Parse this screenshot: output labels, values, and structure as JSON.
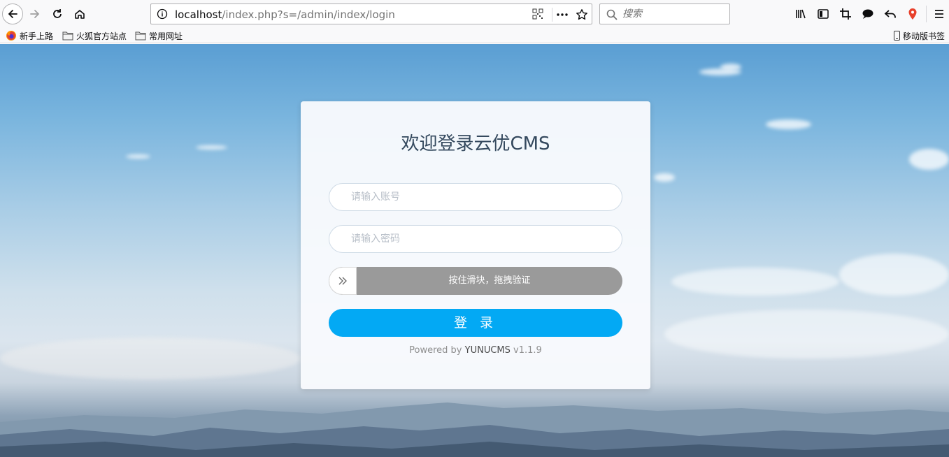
{
  "browser": {
    "url_host": "localhost",
    "url_path": "/index.php?s=/admin/index/login",
    "search_placeholder": "搜索"
  },
  "bookmarks": [
    {
      "label": "新手上路",
      "icon": "firefox-icon"
    },
    {
      "label": "火狐官方站点",
      "icon": "folder-icon"
    },
    {
      "label": "常用网址",
      "icon": "folder-icon"
    }
  ],
  "mobile_bookmarks": "移动版书签",
  "login": {
    "title": "欢迎登录云优CMS",
    "username_placeholder": "请输入账号",
    "password_placeholder": "请输入密码",
    "slider_text": "按住滑块，拖拽验证",
    "submit_label": "登 录",
    "powered_prefix": "Powered by",
    "powered_brand": "YUNUCMS",
    "powered_version": "v1.1.9"
  },
  "colors": {
    "accent": "#03a9f4",
    "slider_track": "#9a9a9a",
    "title": "#34495e"
  }
}
